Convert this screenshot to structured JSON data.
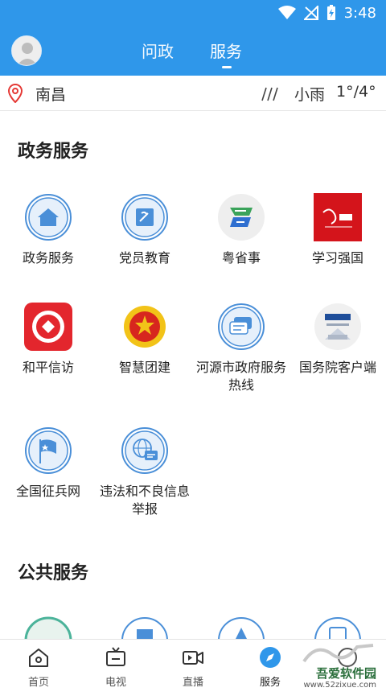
{
  "status_bar": {
    "time": "3:48"
  },
  "header": {
    "tabs": [
      {
        "label": "问政",
        "active": false
      },
      {
        "label": "服务",
        "active": true
      }
    ],
    "accent_color": "#2f97ea"
  },
  "weather": {
    "city": "南昌",
    "condition": "小雨",
    "temperature": "1°/4°"
  },
  "sections": [
    {
      "title": "政务服务",
      "items": [
        {
          "label": "政务服务",
          "icon": "home-icon"
        },
        {
          "label": "党员教育",
          "icon": "party-flag-icon"
        },
        {
          "label": "粤省事",
          "icon": "yueshengshi-icon"
        },
        {
          "label": "学习强国",
          "icon": "xuexi-qiangguo-icon"
        },
        {
          "label": "和平信访",
          "icon": "heping-xinfang-icon"
        },
        {
          "label": "智慧团建",
          "icon": "youth-league-icon"
        },
        {
          "label": "河源市政府服务热线",
          "icon": "chat-bubbles-icon"
        },
        {
          "label": "国务院客户端",
          "icon": "state-council-icon"
        },
        {
          "label": "全国征兵网",
          "icon": "flag-icon"
        },
        {
          "label": "违法和不良信息举报",
          "icon": "globe-report-icon"
        }
      ]
    },
    {
      "title": "公共服务",
      "items": []
    }
  ],
  "bottom_nav": [
    {
      "label": "首页",
      "icon": "home-outline-icon"
    },
    {
      "label": "电视",
      "icon": "tv-icon"
    },
    {
      "label": "直播",
      "icon": "video-camera-icon"
    },
    {
      "label": "服务",
      "icon": "compass-icon",
      "active": true
    },
    {
      "label": "",
      "icon": "more-icon"
    }
  ],
  "watermark": {
    "brand": "吾爱软件园",
    "url": "www.52zixue.com"
  }
}
